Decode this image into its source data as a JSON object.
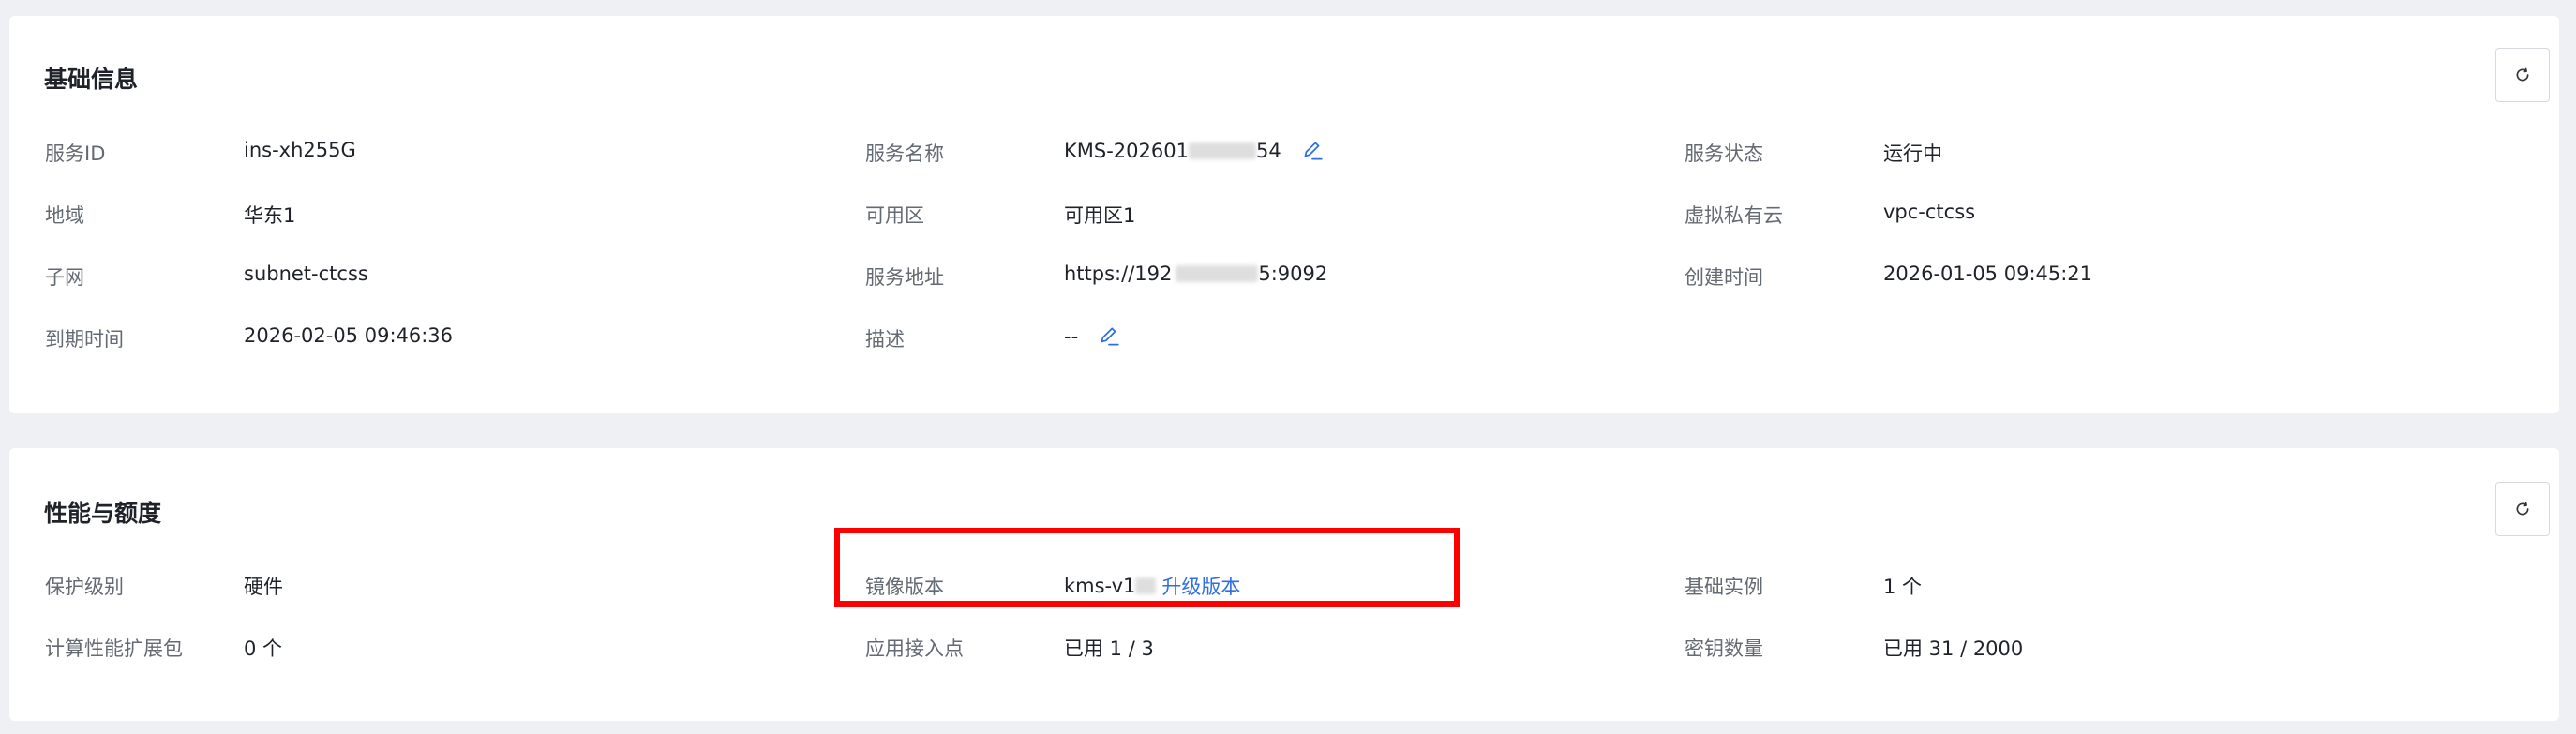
{
  "basic": {
    "title": "基础信息",
    "refresh_icon": "refresh-icon",
    "service_id_label": "服务ID",
    "service_id_value": "ins-xh255G",
    "service_name_label": "服务名称",
    "service_name_prefix": "KMS-202601",
    "service_name_suffix": "54",
    "service_status_label": "服务状态",
    "service_status_value": "运行中",
    "region_label": "地域",
    "region_value": "华东1",
    "zone_label": "可用区",
    "zone_value": "可用区1",
    "vpc_label": "虚拟私有云",
    "vpc_value": "vpc-ctcss",
    "subnet_label": "子网",
    "subnet_value": "subnet-ctcss",
    "address_label": "服务地址",
    "address_prefix": "https://192",
    "address_suffix": "5:9092",
    "created_label": "创建时间",
    "created_value": "2026-01-05 09:45:21",
    "expire_label": "到期时间",
    "expire_value": "2026-02-05 09:46:36",
    "desc_label": "描述",
    "desc_value": "--"
  },
  "perf": {
    "title": "性能与额度",
    "protect_label": "保护级别",
    "protect_value": "硬件",
    "image_label": "镜像版本",
    "image_prefix": "kms-v1",
    "upgrade_link": "升级版本",
    "base_instance_label": "基础实例",
    "base_instance_value": "1 个",
    "compute_pack_label": "计算性能扩展包",
    "compute_pack_value": "0 个",
    "endpoint_label": "应用接入点",
    "endpoint_value": "已用 1 / 3",
    "key_count_label": "密钥数量",
    "key_count_value": "已用 31 / 2000"
  },
  "colors": {
    "accent": "#2f6fe4",
    "highlight": "#ff0000",
    "label": "#646a73",
    "value": "#1f2329",
    "background": "#eef0f3"
  }
}
